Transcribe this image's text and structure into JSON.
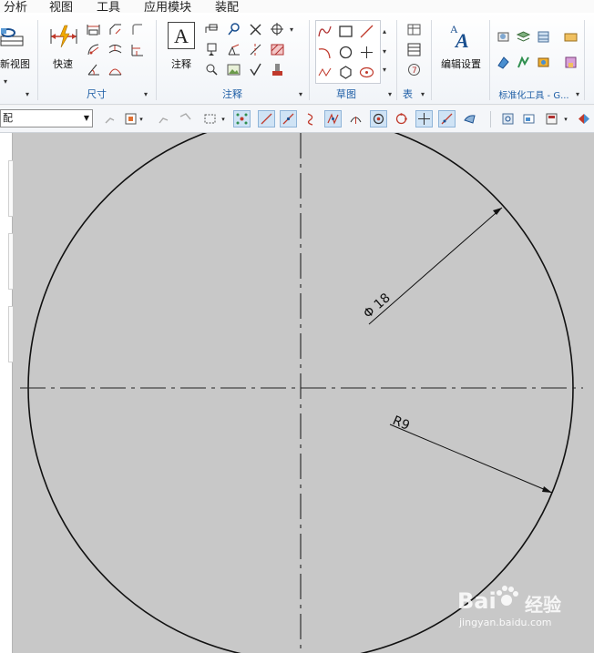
{
  "menu": {
    "items": [
      "分析",
      "视图",
      "工具",
      "应用模块",
      "装配"
    ]
  },
  "ribbon": {
    "big_buttons": {
      "new_view": "新视图",
      "quick_dimension": "快速",
      "annotation": "注释",
      "edit_settings": "编辑设置"
    },
    "groups": {
      "dimension": "尺寸",
      "annotation": "注释",
      "sketch": "草图",
      "table": "表",
      "standard_tools": "标准化工具 - G..."
    }
  },
  "selection_bar": {
    "filter_value": "配"
  },
  "drawing": {
    "dim_diameter": "Φ 18",
    "dim_radius": "R9"
  },
  "watermark": {
    "brand": "Bai",
    "brand_cn": "经验",
    "url": "jingyan.baidu.com"
  },
  "colors": {
    "canvas_bg": "#c8c8c8",
    "ribbon_group_title": "#1f5fa6",
    "toggle_active": "#cfe3f5"
  }
}
